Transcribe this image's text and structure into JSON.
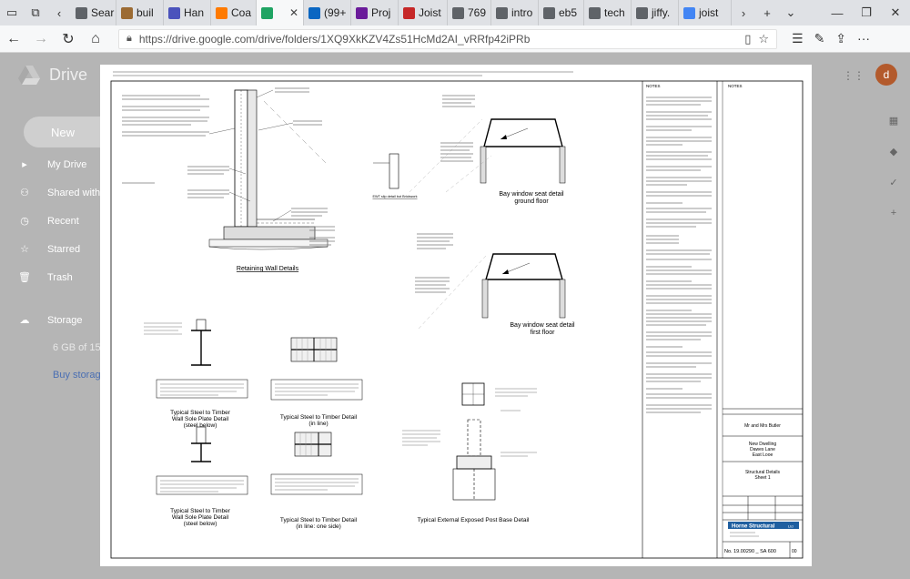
{
  "browser": {
    "tabs": [
      {
        "label": "Sear",
        "icon": "page-icon",
        "color": "#5f6368"
      },
      {
        "label": "buil",
        "icon": "pencil-icon",
        "color": "#9c6b33"
      },
      {
        "label": "Han",
        "icon": "teams-icon",
        "color": "#4b53bc"
      },
      {
        "label": "Coa",
        "icon": "chat-icon",
        "color": "#ff7a00"
      },
      {
        "label": "",
        "icon": "drive-icon",
        "color": "#1fa463",
        "active": true
      },
      {
        "label": "(99+",
        "icon": "linkedin-icon",
        "color": "#0a66c2"
      },
      {
        "label": "Proj",
        "icon": "zoho-icon",
        "color": "#6a1b9a"
      },
      {
        "label": "Joist",
        "icon": "flag-icon",
        "color": "#c62828"
      },
      {
        "label": "769",
        "icon": "page-icon",
        "color": "#5f6368"
      },
      {
        "label": "intro",
        "icon": "page-icon",
        "color": "#5f6368"
      },
      {
        "label": "eb5",
        "icon": "page-icon",
        "color": "#5f6368"
      },
      {
        "label": "tech",
        "icon": "page-icon",
        "color": "#5f6368"
      },
      {
        "label": "jiffy.",
        "icon": "page-icon",
        "color": "#5f6368"
      },
      {
        "label": "joist",
        "icon": "google-icon",
        "color": "#4285f4"
      }
    ],
    "url": "https://drive.google.com/drive/folders/1XQ9XkKZV4Zs51HcMd2AI_vRRfp42iPRb"
  },
  "drive": {
    "title": "Drive",
    "new_label": "New",
    "menu": [
      {
        "label": "My Drive",
        "icon": "my-drive-icon"
      },
      {
        "label": "Shared with",
        "icon": "shared-icon"
      },
      {
        "label": "Recent",
        "icon": "recent-icon"
      },
      {
        "label": "Starred",
        "icon": "star-icon"
      },
      {
        "label": "Trash",
        "icon": "trash-icon"
      },
      {
        "label": "Storage",
        "icon": "cloud-icon"
      }
    ],
    "storage_text": "6 GB of 15",
    "buy_storage": "Buy storag",
    "avatar_letter": "d"
  },
  "drawing": {
    "title_main": "Retaining Wall Details",
    "title_bay1": "Bay window seat detail",
    "title_bay1b": "ground floor",
    "title_bay2": "Bay window seat detail",
    "title_bay2b": "first floor",
    "title_wsp1a": "Typical Steel to Timber",
    "title_wsp1b": "Wall Sole Plate Detail",
    "title_wsp1c": "(steel below)",
    "title_std1a": "Typical Steel to Timber Detail",
    "title_std1b": "(in line)",
    "title_wsp2a": "Typical Steel to Timber",
    "title_wsp2b": "Wall Sole Plate Detail",
    "title_wsp2c": "(steel below)",
    "title_std2a": "Typical Steel to Timber Detail",
    "title_std2b": "(in line:  one side)",
    "title_post": "Typical External Exposed Post Base Detail",
    "note_ewt": "EWT slip detail but Brickwork",
    "ground_floor_note": "Bay window seat detail",
    "notes_title": "NOTES",
    "notes_title2": "NOTES",
    "client": "Mr and Mrs Butler",
    "project1": "New Dwelling",
    "project2": "Dawes Lane",
    "project3": "East Looe",
    "sheet_title1": "Structural Details",
    "sheet_title2": "Sheet 1",
    "firm": "Horne Structural",
    "ltd": "Ltd",
    "drawing_no": "No. 19.00290 _ SA 600",
    "rev": "00",
    "sheet_no": "No."
  }
}
